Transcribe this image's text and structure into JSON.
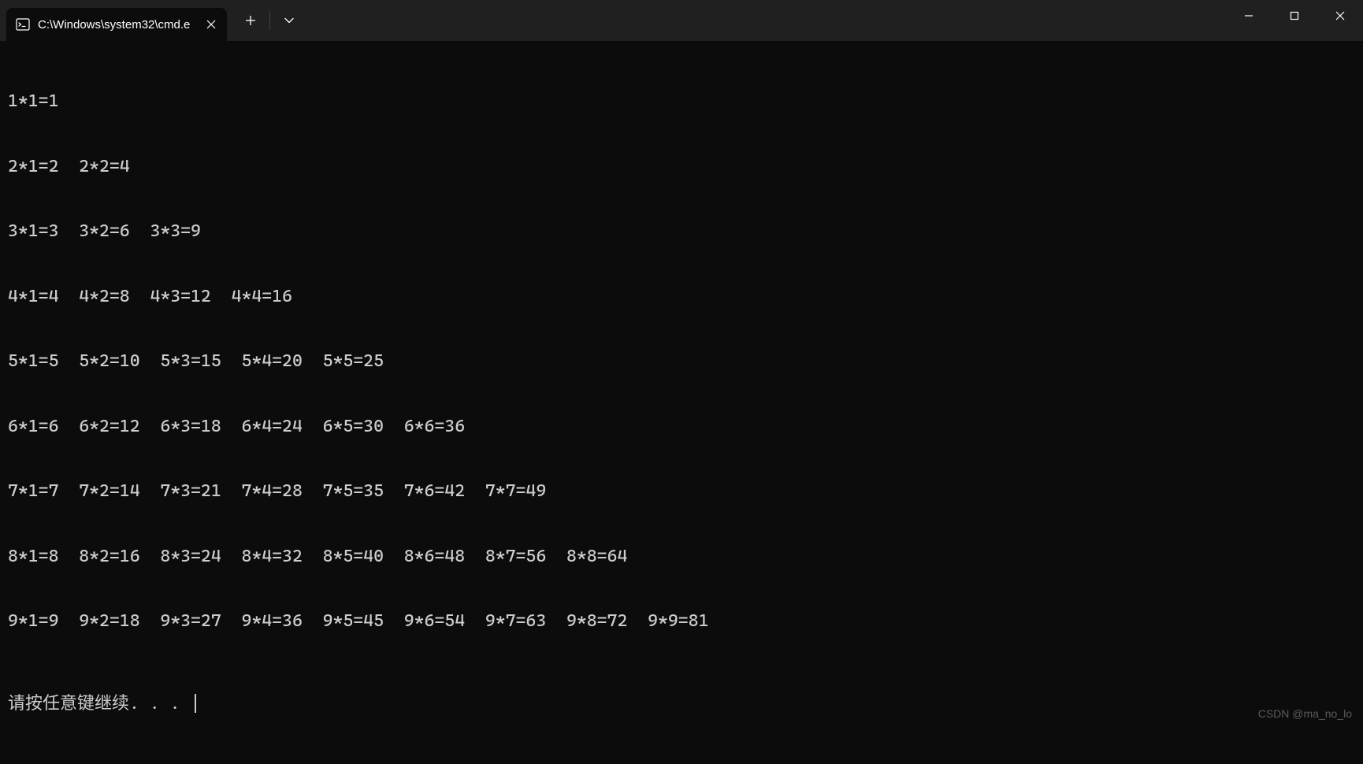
{
  "tab": {
    "title": "C:\\Windows\\system32\\cmd.e"
  },
  "output": {
    "lines": [
      "1*1=1",
      "2*1=2  2*2=4",
      "3*1=3  3*2=6  3*3=9",
      "4*1=4  4*2=8  4*3=12  4*4=16",
      "5*1=5  5*2=10  5*3=15  5*4=20  5*5=25",
      "6*1=6  6*2=12  6*3=18  6*4=24  6*5=30  6*6=36",
      "7*1=7  7*2=14  7*3=21  7*4=28  7*5=35  7*6=42  7*7=49",
      "8*1=8  8*2=16  8*3=24  8*4=32  8*5=40  8*6=48  8*7=56  8*8=64",
      "9*1=9  9*2=18  9*3=27  9*4=36  9*5=45  9*6=54  9*7=63  9*8=72  9*9=81"
    ],
    "prompt": "请按任意键继续. . . "
  },
  "watermark": "CSDN @ma_no_lo"
}
